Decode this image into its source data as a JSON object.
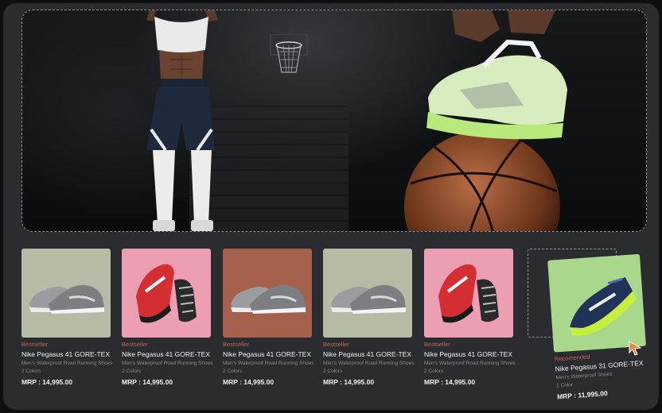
{
  "hero": {
    "image_name": "basketball-hero-image"
  },
  "products": [
    {
      "badge": "Bestseller",
      "name": "Nike Pegasus 41 GORE-TEX",
      "desc": "Men's Waterproof Road Running Shoes",
      "colors": "2 Colors",
      "price": "MRP : 14,995.00",
      "bg": "#b6bba5",
      "shoe": "grey-pair"
    },
    {
      "badge": "Bestseller",
      "name": "Nike Pegasus 41 GORE-TEX",
      "desc": "Men's Waterproof Road Running Shoes",
      "colors": "2 Colors",
      "price": "MRP : 14,995.00",
      "bg": "#ec9fb3",
      "shoe": "red-pair"
    },
    {
      "badge": "Bestseller",
      "name": "Nike Pegasus 41 GORE-TEX",
      "desc": "Men's Waterproof Road Running Shoes",
      "colors": "2 Colors",
      "price": "MRP : 14,995.00",
      "bg": "#a5614c",
      "shoe": "grey-pair"
    },
    {
      "badge": "Bestseller",
      "name": "Nike Pegasus 41 GORE-TEX",
      "desc": "Men's Waterproof Road Running Shoes",
      "colors": "2 Colors",
      "price": "MRP : 14,995.00",
      "bg": "#b6bba5",
      "shoe": "grey-pair"
    },
    {
      "badge": "Bestseller",
      "name": "Nike Pegasus 41 GORE-TEX",
      "desc": "Men's Waterproof Road Running Shoes",
      "colors": "2 Colors",
      "price": "MRP : 14,995.00",
      "bg": "#ec9fb3",
      "shoe": "red-pair"
    }
  ],
  "dragged_product": {
    "badge": "Recomended",
    "name": "Nike Pegasus 31 GORE-TEX",
    "desc": "Men's Waterproof Shoes",
    "colors": "1 Color",
    "price": "MRP : 11,995.00",
    "bg": "#a9d88c",
    "shoe": "blue-single"
  },
  "colors": {
    "badge_text": "#c2655a",
    "cursor": "#e8843c",
    "panel": "#2b2c30"
  }
}
